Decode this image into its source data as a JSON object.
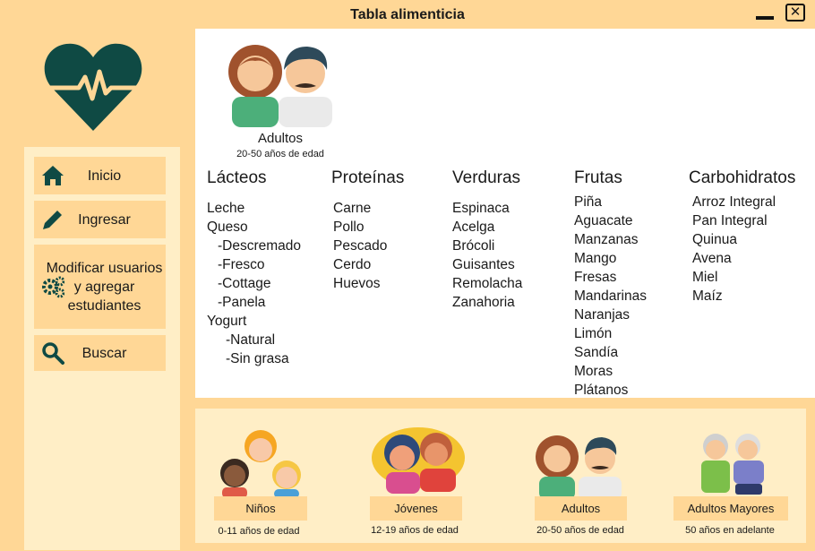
{
  "window": {
    "title": "Tabla alimenticia",
    "minimize_icon": "minimize-icon",
    "close_icon": "close-icon"
  },
  "colors": {
    "background": "#ffd796",
    "panel": "#ffeec6",
    "accent": "#0f4a44"
  },
  "sidebar": {
    "items": [
      {
        "label": "Inicio",
        "icon": "home-icon"
      },
      {
        "label": "Ingresar",
        "icon": "pencil-icon"
      },
      {
        "label": "Modificar usuarios y agregar estudiantes",
        "icon": "gears-icon"
      },
      {
        "label": "Buscar",
        "icon": "search-icon"
      }
    ]
  },
  "hero": {
    "label": "Adultos",
    "sub": "20-50 años de edad"
  },
  "columns": {
    "lacteos": {
      "title": "Lácteos",
      "items": [
        "Leche",
        "Queso",
        "-Descremado",
        "-Fresco",
        "-Cottage",
        "-Panela",
        "Yogurt",
        "-Natural",
        "-Sin grasa"
      ]
    },
    "proteinas": {
      "title": "Proteínas",
      "items": [
        "Carne",
        "Pollo",
        "Pescado",
        "Cerdo",
        "Huevos"
      ]
    },
    "verduras": {
      "title": "Verduras",
      "items": [
        "Espinaca",
        "Acelga",
        "Brócoli",
        "Guisantes",
        "Remolacha",
        "Zanahoria"
      ]
    },
    "frutas": {
      "title": "Frutas",
      "items": [
        "Piña",
        "Aguacate",
        "Manzanas",
        "Mango",
        "Fresas",
        "Mandarinas",
        "Naranjas",
        "Limón",
        "Sandía",
        "Moras",
        "Plátanos"
      ]
    },
    "carbohidratos": {
      "title": "Carbohidratos",
      "items": [
        "Arroz Integral",
        "Pan Integral",
        "Quinua",
        "Avena",
        "Miel",
        "Maíz"
      ]
    }
  },
  "groups": [
    {
      "label": "Niños",
      "sub": "0-11 años de edad"
    },
    {
      "label": "Jóvenes",
      "sub": "12-19 años de edad"
    },
    {
      "label": "Adultos",
      "sub": "20-50 años de edad"
    },
    {
      "label": "Adultos Mayores",
      "sub": "50 años en adelante"
    }
  ]
}
